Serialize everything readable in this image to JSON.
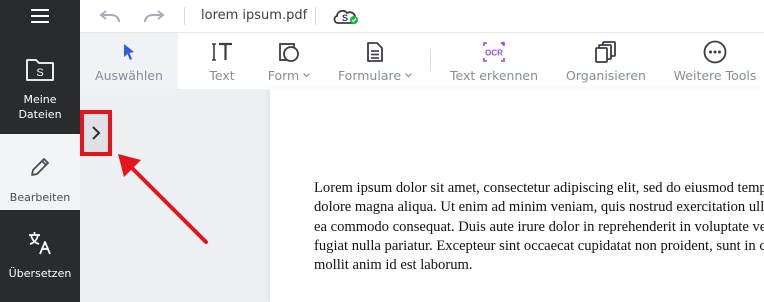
{
  "rail": {
    "files_label_line1": "Meine",
    "files_label_line2": "Dateien",
    "edit_label": "Bearbeiten",
    "translate_label": "Übersetzen",
    "file_badge": "S"
  },
  "topbar": {
    "filename": "lorem ipsum.pdf",
    "cloud_badge": "S"
  },
  "toolbar": {
    "select_label": "Auswählen",
    "text_label": "Text",
    "form_label": "Form",
    "forms_label": "Formulare",
    "ocr_label": "Text erkennen",
    "ocr_icon_text": "OCR",
    "organize_label": "Organisieren",
    "more_label": "Weitere Tools"
  },
  "document": {
    "lines": [
      "Lorem ipsum dolor sit amet, consectetur adipiscing elit, sed do eiusmod tempor incididunt ut labore et",
      "dolore magna aliqua. Ut enim ad minim veniam, quis nostrud exercitation ullamco laboris nisi ut aliquip ex",
      "ea commodo consequat. Duis aute irure dolor in reprehenderit in voluptate velit esse cillum dolore eu",
      "fugiat nulla pariatur. Excepteur sint occaecat cupidatat non proident, sunt in culpa qui officia deserunt",
      "mollit anim id est laborum."
    ]
  },
  "colors": {
    "rail": "#2a2b2e",
    "accent_blue": "#2f5fe0",
    "ocr_purple": "#8a4fe8",
    "highlight_red": "#e3141b",
    "cloud_green": "#19b34a"
  }
}
